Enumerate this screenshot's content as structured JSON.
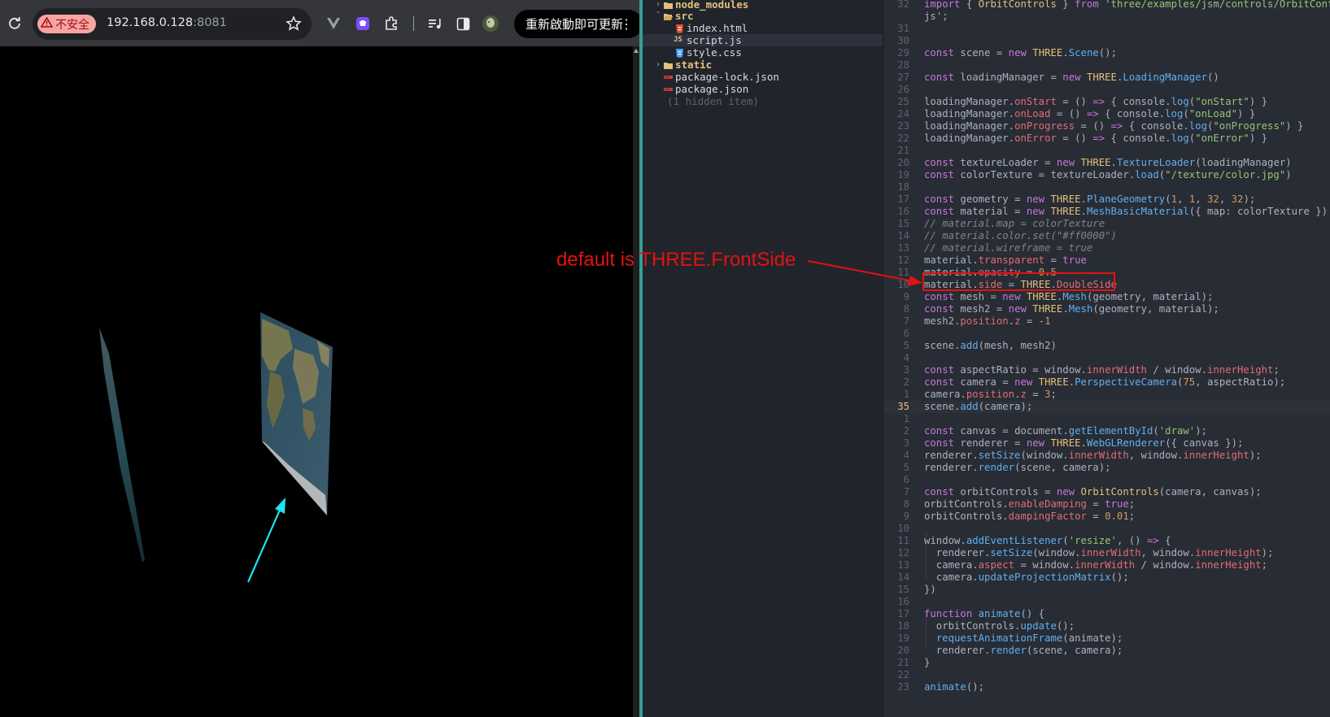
{
  "browser": {
    "security_label": "不安全",
    "url_host": "192.168.0.128",
    "url_port": ":8081",
    "update_label": "重新啟動即可更新",
    "kebab": "⋮",
    "toolbar_icons": [
      "reload-icon",
      "bookmark-star-icon",
      "vue-devtools-icon",
      "extension-purple-icon",
      "extensions-puzzle-icon",
      "media-controls-icon",
      "side-panel-icon",
      "profile-avatar-icon"
    ]
  },
  "explorer": {
    "items": [
      {
        "label": "node_modules",
        "kind": "folder",
        "icon": "folder-icon",
        "expanded": false
      },
      {
        "label": "src",
        "kind": "folder",
        "icon": "folder-open-icon",
        "expanded": true
      },
      {
        "label": "index.html",
        "kind": "file",
        "icon": "html-file-icon",
        "color": "#e44d26"
      },
      {
        "label": "script.js",
        "kind": "file",
        "icon": "js-file-icon",
        "color": "#e5c07b",
        "selected": true
      },
      {
        "label": "style.css",
        "kind": "file",
        "icon": "css-file-icon",
        "color": "#42a5f5"
      },
      {
        "label": "static",
        "kind": "folder",
        "icon": "folder-icon",
        "expanded": false
      },
      {
        "label": "package-lock.json",
        "kind": "file",
        "icon": "npm-file-icon",
        "color": "#cb3837"
      },
      {
        "label": "package.json",
        "kind": "file",
        "icon": "npm-file-icon",
        "color": "#cb3837"
      },
      {
        "label": "(1 hidden item)",
        "kind": "hidden"
      }
    ],
    "src_prefix": "ˇ"
  },
  "code": {
    "lines": [
      {
        "n": "32",
        "t": "import { OrbitControls } from 'three/examples/jsm/controls/OrbitContro"
      },
      {
        "n": "",
        "t": "js';"
      },
      {
        "n": "31",
        "t": ""
      },
      {
        "n": "30",
        "t": ""
      },
      {
        "n": "29",
        "t": "const scene = new THREE.Scene();"
      },
      {
        "n": "28",
        "t": ""
      },
      {
        "n": "27",
        "t": "const loadingManager = new THREE.LoadingManager()"
      },
      {
        "n": "26",
        "t": ""
      },
      {
        "n": "25",
        "t": "loadingManager.onStart = () => { console.log(\"onStart\") }"
      },
      {
        "n": "24",
        "t": "loadingManager.onLoad = () => { console.log(\"onLoad\") }"
      },
      {
        "n": "23",
        "t": "loadingManager.onProgress = () => { console.log(\"onProgress\") }"
      },
      {
        "n": "22",
        "t": "loadingManager.onError = () => { console.log(\"onError\") }"
      },
      {
        "n": "21",
        "t": ""
      },
      {
        "n": "20",
        "t": "const textureLoader = new THREE.TextureLoader(loadingManager)"
      },
      {
        "n": "19",
        "t": "const colorTexture = textureLoader.load(\"/texture/color.jpg\")"
      },
      {
        "n": "18",
        "t": ""
      },
      {
        "n": "17",
        "t": "const geometry = new THREE.PlaneGeometry(1, 1, 32, 32);"
      },
      {
        "n": "16",
        "t": "const material = new THREE.MeshBasicMaterial({ map: colorTexture })"
      },
      {
        "n": "15",
        "t": "// material.map = colorTexture"
      },
      {
        "n": "14",
        "t": "// material.color.set(\"#ff0000\")"
      },
      {
        "n": "13",
        "t": "// material.wireframe = true"
      },
      {
        "n": "12",
        "t": "material.transparent = true"
      },
      {
        "n": "11",
        "t": "material.opacity = 0.5"
      },
      {
        "n": "10",
        "t": "material.side = THREE.DoubleSide"
      },
      {
        "n": "9",
        "t": "const mesh = new THREE.Mesh(geometry, material);"
      },
      {
        "n": "8",
        "t": "const mesh2 = new THREE.Mesh(geometry, material);"
      },
      {
        "n": "7",
        "t": "mesh2.position.z = -1"
      },
      {
        "n": "6",
        "t": ""
      },
      {
        "n": "5",
        "t": "scene.add(mesh, mesh2)"
      },
      {
        "n": "4",
        "t": ""
      },
      {
        "n": "3",
        "t": "const aspectRatio = window.innerWidth / window.innerHeight;"
      },
      {
        "n": "2",
        "t": "const camera = new THREE.PerspectiveCamera(75, aspectRatio);"
      },
      {
        "n": "1",
        "t": "camera.position.z = 3;"
      },
      {
        "n": "35",
        "t": "scene.add(camera);",
        "current": true
      },
      {
        "n": "1",
        "t": ""
      },
      {
        "n": "2",
        "t": "const canvas = document.getElementById('draw');"
      },
      {
        "n": "3",
        "t": "const renderer = new THREE.WebGLRenderer({ canvas });"
      },
      {
        "n": "4",
        "t": "renderer.setSize(window.innerWidth, window.innerHeight);"
      },
      {
        "n": "5",
        "t": "renderer.render(scene, camera);"
      },
      {
        "n": "6",
        "t": ""
      },
      {
        "n": "7",
        "t": "const orbitControls = new OrbitControls(camera, canvas);"
      },
      {
        "n": "8",
        "t": "orbitControls.enableDamping = true;"
      },
      {
        "n": "9",
        "t": "orbitControls.dampingFactor = 0.01;"
      },
      {
        "n": "10",
        "t": ""
      },
      {
        "n": "11",
        "t": "window.addEventListener('resize', () => {"
      },
      {
        "n": "12",
        "t": "  renderer.setSize(window.innerWidth, window.innerHeight);"
      },
      {
        "n": "13",
        "t": "  camera.aspect = window.innerWidth / window.innerHeight;"
      },
      {
        "n": "14",
        "t": "  camera.updateProjectionMatrix();"
      },
      {
        "n": "15",
        "t": "})"
      },
      {
        "n": "16",
        "t": ""
      },
      {
        "n": "17",
        "t": "function animate() {"
      },
      {
        "n": "18",
        "t": "  orbitControls.update();"
      },
      {
        "n": "19",
        "t": "  requestAnimationFrame(animate);"
      },
      {
        "n": "20",
        "t": "  renderer.render(scene, camera);"
      },
      {
        "n": "21",
        "t": "}"
      },
      {
        "n": "22",
        "t": ""
      },
      {
        "n": "23",
        "t": "animate();"
      }
    ]
  },
  "annotation": {
    "text": "default is THREE.FrontSide",
    "color": "#e1130f",
    "pointer_color": "#19e6f0"
  },
  "colors": {
    "keyword": "#c678dd",
    "string": "#98c379",
    "number": "#d19a66",
    "function": "#61afef",
    "property": "#e06c75",
    "comment": "#7f848e",
    "class": "#e5c07b",
    "op": "#56b6c2"
  }
}
